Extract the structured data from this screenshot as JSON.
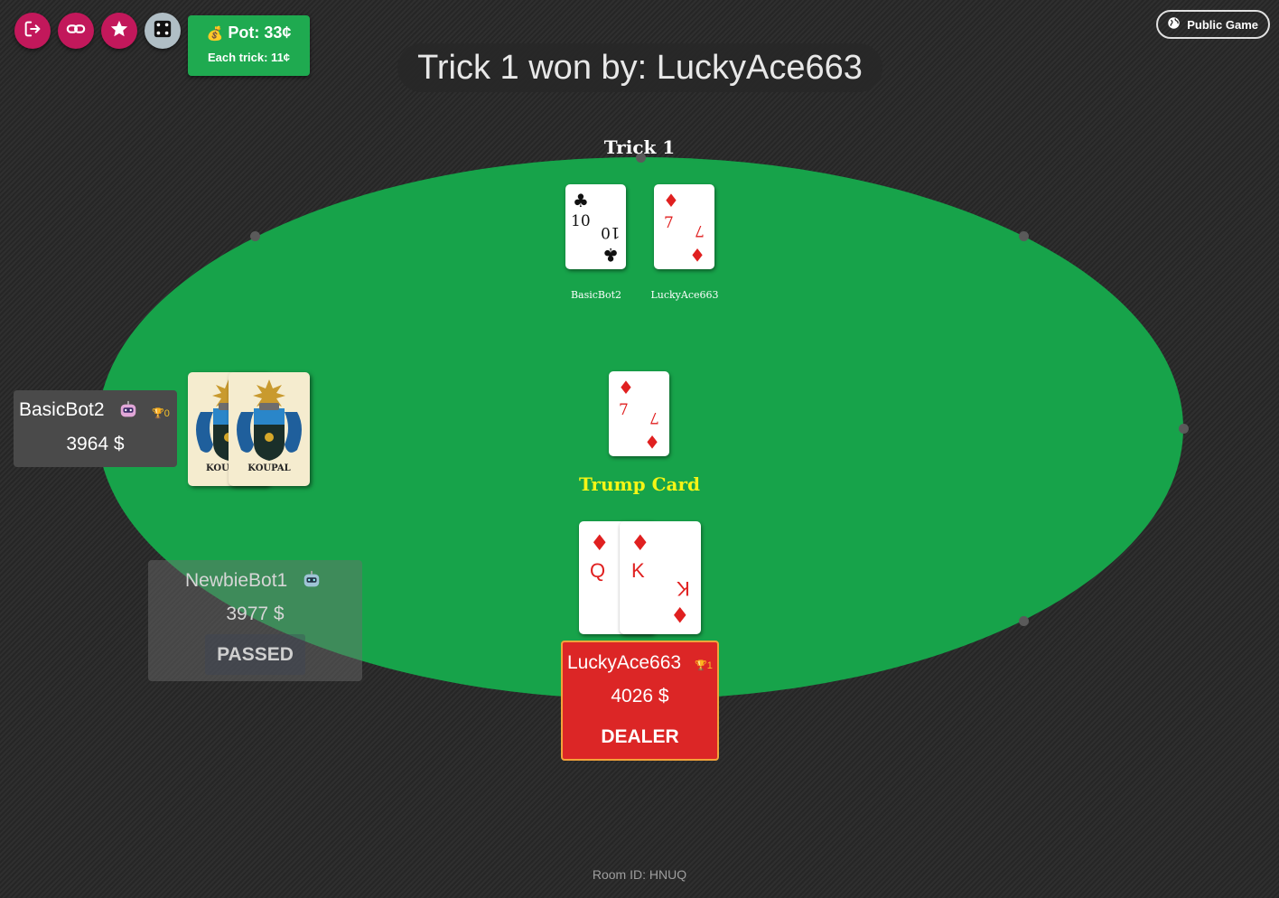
{
  "toolbar": {
    "buttons": [
      {
        "icon": "logout-icon"
      },
      {
        "icon": "link-icon"
      },
      {
        "icon": "star-icon"
      },
      {
        "icon": "dice-icon"
      }
    ],
    "pot_emoji": "💰",
    "pot_label": "Pot: 33¢",
    "each_trick_label": "Each trick: 11¢",
    "public_game_label": "Public Game"
  },
  "headline": "Trick 1 won by: LuckyAce663",
  "trick": {
    "title": "Trick 1",
    "cards": [
      {
        "rank": "10",
        "suit": "♣",
        "color": "#111111",
        "player": "BasicBot2"
      },
      {
        "rank": "7",
        "suit": "♦",
        "color": "#e02020",
        "player": "LuckyAce663"
      }
    ]
  },
  "trump": {
    "label": "Trump Card",
    "card": {
      "rank": "7",
      "suit": "♦",
      "color": "#e02020"
    }
  },
  "my_hand": [
    {
      "rank": "Q",
      "suit": "♦"
    },
    {
      "rank": "K",
      "suit": "♦"
    }
  ],
  "opponent_hand": {
    "back_text": "KOUPAL",
    "back_text_partial": "KOU"
  },
  "players": {
    "basicbot2": {
      "name": "BasicBot2",
      "trophies": "0",
      "balance": "3964 $"
    },
    "newbiebot1": {
      "name": "NewbieBot1",
      "balance": "3977 $",
      "status": "PASSED"
    },
    "luckyace663": {
      "name": "LuckyAce663",
      "trophies": "1",
      "balance": "4026 $",
      "role": "DEALER"
    }
  },
  "footer": {
    "room_id": "Room ID: HNUQ"
  },
  "colors": {
    "felt": "#17a34a",
    "accent": "#c2185b",
    "pot": "#1faa50",
    "dealer_box": "#dc2626",
    "trump_text": "#f5f516"
  }
}
